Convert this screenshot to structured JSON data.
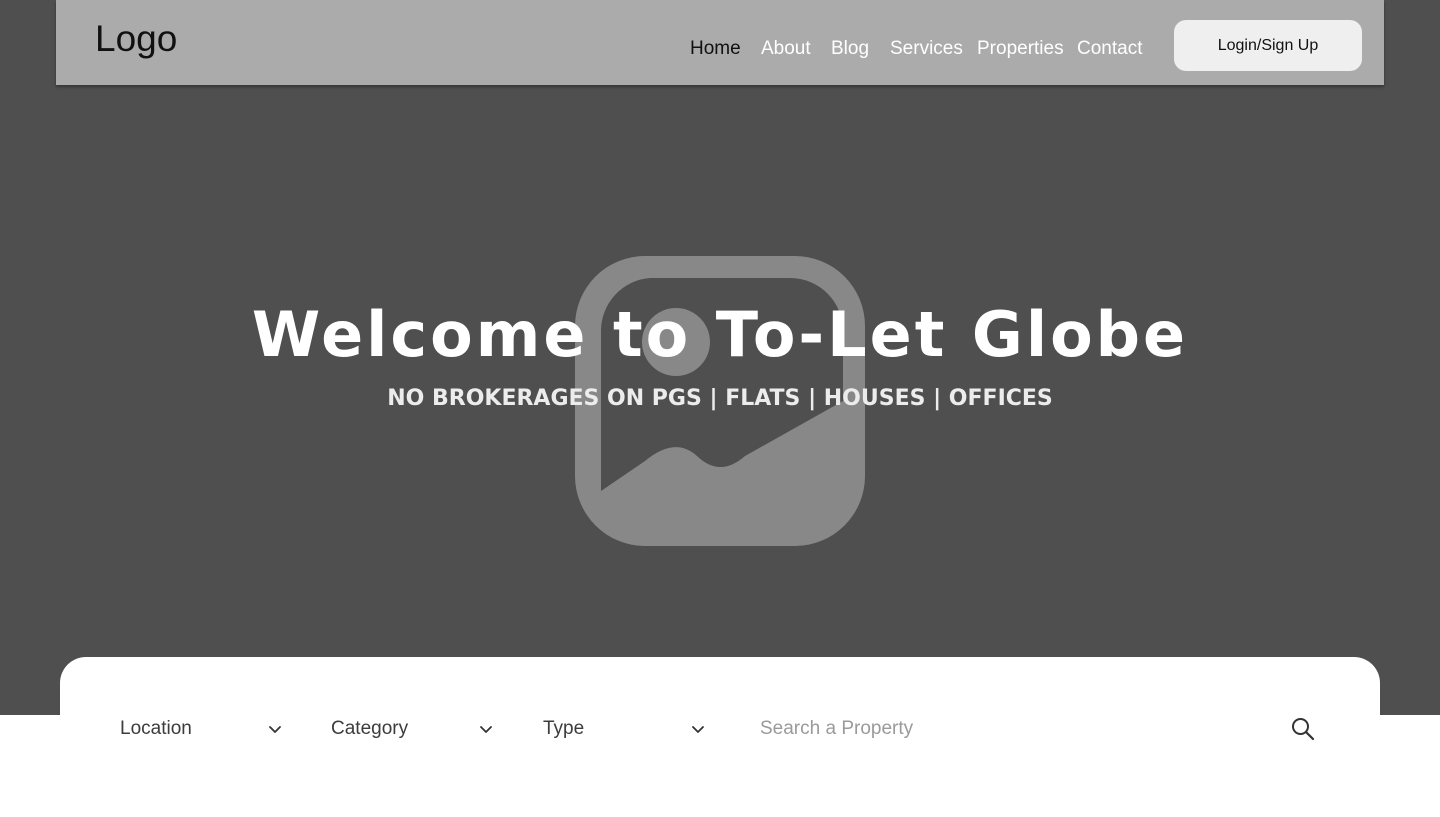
{
  "header": {
    "logo": "Logo",
    "nav": [
      {
        "label": "Home",
        "active": true
      },
      {
        "label": "About"
      },
      {
        "label": "Blog"
      },
      {
        "label": "Services"
      },
      {
        "label": "Properties"
      },
      {
        "label": "Contact"
      }
    ],
    "login_label": "Login/Sign Up"
  },
  "hero": {
    "title": "Welcome to To-Let Globe",
    "subtitle": "NO BROKERAGES ON PGS | FLATS | HOUSES | OFFICES",
    "background_icon": "image-placeholder-icon"
  },
  "search": {
    "filters": [
      {
        "label": "Location",
        "icon": "chevron-down-icon"
      },
      {
        "label": "Category",
        "icon": "chevron-down-icon"
      },
      {
        "label": "Type",
        "icon": "chevron-down-icon"
      }
    ],
    "placeholder": "Search a Property",
    "button_icon": "search-icon"
  },
  "colors": {
    "hero_bg": "#4f4f4f",
    "navbar_bg": "#ababab",
    "login_bg": "#efefef",
    "card_bg": "#ffffff"
  }
}
